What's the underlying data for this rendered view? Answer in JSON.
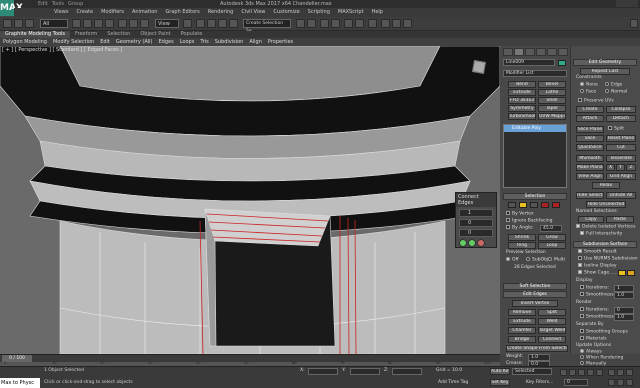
{
  "window": {
    "title": "Autodesk 3ds Max 2017 x64     Chandelier.max",
    "logo": "MAX"
  },
  "title_menu": [
    "Edit",
    "Tools",
    "Group",
    "Views",
    "Create",
    "Modifiers",
    "Animation",
    "Graph Editors",
    "Rendering",
    "Civil View",
    "Customize",
    "Scripting",
    "MAXScript",
    "Help"
  ],
  "toolbar": {
    "selection_filter": "All",
    "ref_coord": "View",
    "named_sel": "Create Selection Se"
  },
  "ribbon": {
    "tabs": [
      "Graphite Modeling Tools",
      "Freeform",
      "Selection",
      "Object Paint",
      "Populate"
    ],
    "subtabs": [
      "Polygon Modeling",
      "Modify Selection",
      "Edit",
      "Geometry (All)",
      "Edges",
      "Loops",
      "Tris",
      "Subdivision",
      "Align",
      "Properties"
    ]
  },
  "viewport": {
    "label": "[ + ] [ Perspective ] [ Standard ] [ Edged Faces ]"
  },
  "connect_edges": {
    "title": "Connect Edges",
    "segments": "1",
    "pinch": "0",
    "slide": "0"
  },
  "modify_panel": {
    "object_name": "Line009",
    "modifier_list": "Modifier List",
    "buttons": [
      "Bend",
      "Bevel",
      "Extrude",
      "Lathe",
      "FFD 3x3x3",
      "Shell",
      "Symmetry",
      "Taper",
      "TurboSmooth",
      "UVW Mapping Cl"
    ],
    "stack_item": "Editable Poly",
    "selection_title": "Selection",
    "by_vertex": "By Vertex",
    "ignore_backfacing": "Ignore Backfacing",
    "by_angle": "By Angle:",
    "by_angle_val": "45.0",
    "shrink": "Shrink",
    "grow": "Grow",
    "ring": "Ring",
    "loop": "Loop",
    "preview_selection": "Preview Selection",
    "preview_off": "Off",
    "preview_subobj": "SubObj",
    "preview_multi": "Multi",
    "selected_count": "28 Edges Selected",
    "soft_selection": "Soft Selection",
    "edit_edges": "Edit Edges",
    "insert_vertex": "Insert Vertex",
    "remove": "Remove",
    "split": "Split",
    "extrude": "Extrude",
    "weld": "Weld",
    "chamfer": "Chamfer",
    "target_weld": "Target Weld",
    "bridge": "Bridge",
    "connect": "Connect",
    "create_shape": "Create Shape From Selection",
    "weight_label": "Weight:",
    "weight_val": "1.0",
    "crease_label": "Crease:",
    "crease_val": "0.0"
  },
  "edit_geometry": {
    "title": "Edit Geometry",
    "repeat_last": "Repeat Last",
    "constraints": "Constraints",
    "c_none": "None",
    "c_edge": "Edge",
    "c_face": "Face",
    "c_normal": "Normal",
    "preserve_uvs": "Preserve UVs",
    "create": "Create",
    "collapse": "Collapse",
    "attach": "Attach",
    "detach": "Detach",
    "slice_plane": "Slice Plane",
    "split": "Split",
    "slice": "Slice",
    "reset_plane": "Reset Plane",
    "quickslice": "QuickSlice",
    "cut": "Cut",
    "msmooth": "MSmooth",
    "tessellate": "Tessellate",
    "make_planar": "Make Planar",
    "x": "X",
    "y": "Y",
    "z": "Z",
    "view_align": "View Align",
    "grid_align": "Grid Align",
    "relax": "Relax",
    "hide_selected": "Hide Selected",
    "unhide_all": "Unhide All",
    "hide_unselected": "Hide Unselected",
    "named_selections": "Named Selections:",
    "copy": "Copy",
    "paste": "Paste",
    "delete_isolated": "Delete Isolated Vertices",
    "full_interactivity": "Full Interactivity"
  },
  "subdivision": {
    "title": "Subdivision Surface",
    "smooth_result": "Smooth Result",
    "use_nurms": "Use NURMS Subdivision",
    "isoline": "Isoline Display",
    "show_cage": "Show Cage......",
    "display": "Display",
    "iterations_label": "Iterations:",
    "iterations": "1",
    "smoothness_label": "Smoothness:",
    "smoothness": "1.0",
    "render": "Render",
    "r_iterations": "0",
    "r_smoothness": "1.0",
    "separate_by": "Separate By",
    "smoothing_groups": "Smoothing Groups",
    "materials": "Materials",
    "update_options": "Update Options",
    "always": "Always",
    "when_rendering": "When Rendering",
    "manually": "Manually",
    "cage_colors": [
      "#e8c020",
      "#e0a020"
    ]
  },
  "timeline": {
    "frame": "0 / 100",
    "ticks": [
      "0",
      "10",
      "20",
      "30",
      "40",
      "50",
      "60",
      "70",
      "80",
      "90",
      "100"
    ]
  },
  "status": {
    "objects": "1 Object Selected",
    "prompt": "Click or click-and-drag to select objects",
    "maxscript": "Max to Physc",
    "x_label": "X:",
    "y_label": "Y:",
    "z_label": "Z:",
    "grid": "Grid = 10.0",
    "add_time_tag": "Add Time Tag",
    "auto_key": "Auto Key",
    "set_key": "Set Key",
    "selected": "Selected",
    "key_filters": "Key Filters...",
    "frame_field": "0"
  },
  "colors": {
    "edge_sel": "#cc2222",
    "accent_yellow": "#e8c020"
  }
}
